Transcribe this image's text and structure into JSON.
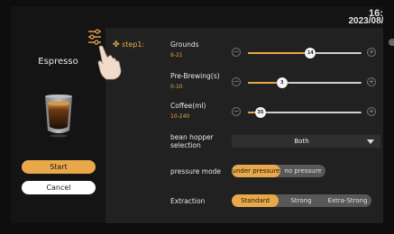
{
  "status": {
    "time": "16:5",
    "date": "2023/08/0"
  },
  "product": {
    "name": "Espresso"
  },
  "buttons": {
    "start": "Start",
    "cancel": "Cancel"
  },
  "step": {
    "label": "step1:"
  },
  "sliders": [
    {
      "label": "Grounds",
      "range": "6-21",
      "value": "14",
      "fraction": 0.55
    },
    {
      "label": "Pre-Brewing(s)",
      "range": "0-10",
      "value": "3",
      "fraction": 0.3
    },
    {
      "label": "Coffee(ml)",
      "range": "10-240",
      "value": "35",
      "fraction": 0.11
    }
  ],
  "bean_hopper": {
    "label_line1": "bean hopper",
    "label_line2": "selection",
    "value": "Both"
  },
  "pressure_mode": {
    "label": "pressure mode",
    "options": [
      "under pressure",
      "no pressure"
    ],
    "selected": "under pressure"
  },
  "extraction": {
    "label": "Extraction",
    "options": [
      "Standard",
      "Strong",
      "Extra-Strong"
    ],
    "selected": "Standard"
  },
  "colors": {
    "accent": "#e9a84a",
    "panel": "#212121",
    "background": "#141414"
  },
  "icons": {
    "settings": "sliders-settings-icon",
    "pointer": "hand-pointer-icon",
    "minus": "minus-circle-icon",
    "plus": "plus-circle-icon",
    "dropdown": "chevron-down-icon"
  }
}
